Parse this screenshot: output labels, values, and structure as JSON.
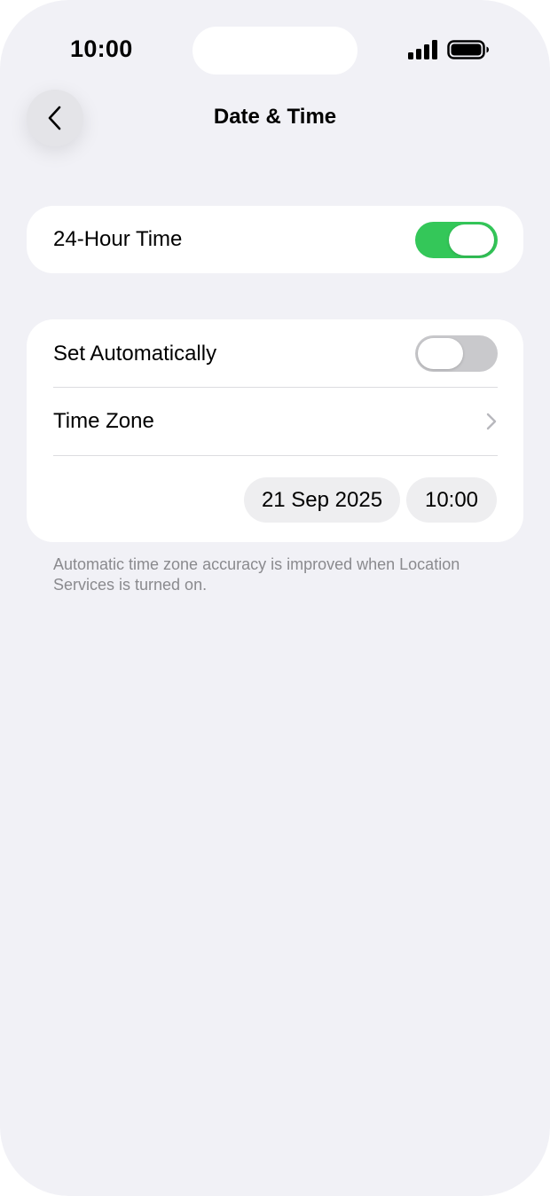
{
  "status_bar": {
    "time": "10:00"
  },
  "nav": {
    "title": "Date & Time",
    "back_icon": "chevron-left-icon"
  },
  "settings": {
    "hour_24": {
      "label": "24-Hour Time",
      "enabled": true
    },
    "set_automatically": {
      "label": "Set Automatically",
      "enabled": false
    },
    "time_zone": {
      "label": "Time Zone"
    },
    "date_value": "21 Sep 2025",
    "time_value": "10:00",
    "footnote": "Automatic time zone accuracy is improved when Location Services is turned on."
  },
  "colors": {
    "background": "#f1f1f6",
    "toggle_on": "#34c759",
    "toggle_off": "#c9c9cc",
    "footnote_text": "#8a8a8e"
  }
}
